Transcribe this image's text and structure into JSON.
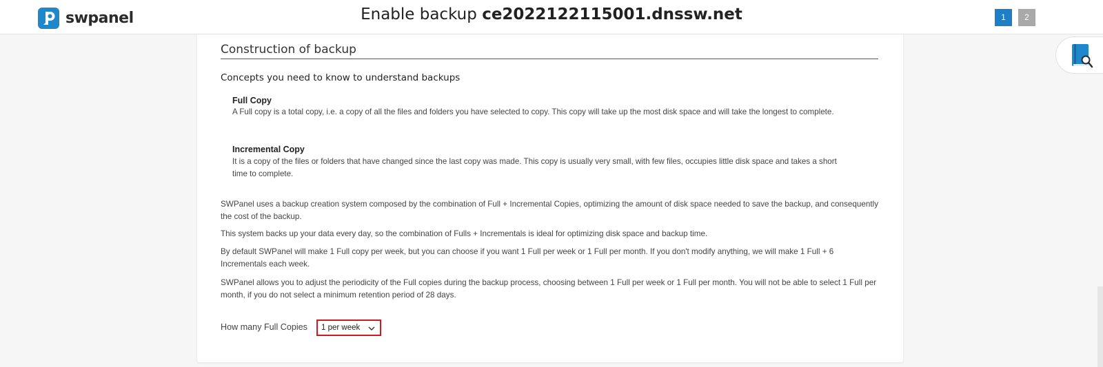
{
  "header": {
    "logo_text": "swpanel",
    "title_prefix": "Enable backup",
    "title_domain": "ce2022122115001.dnssw.net",
    "steps": [
      "1",
      "2"
    ]
  },
  "section": {
    "title": "Construction of backup",
    "concepts_heading": "Concepts you need to know to understand backups",
    "full_copy": {
      "term": "Full Copy",
      "desc": "A Full copy is a total copy, i.e. a copy of all the files and folders you have selected to copy. This copy will take up the most disk space and will take the longest to complete."
    },
    "incremental_copy": {
      "term": "Incremental Copy",
      "desc": "It is a copy of the files or folders that have changed since the last copy was made. This copy is usually very small, with few files, occupies little disk space and takes a short time to complete."
    },
    "paragraphs": [
      "SWPanel uses a backup creation system composed by the combination of Full + Incremental Copies, optimizing the amount of disk space needed to save the backup, and consequently the cost of the backup.",
      "This system backs up your data every day, so the combination of Fulls + Incrementals is ideal for optimizing disk space and backup time.",
      "By default SWPanel will make 1 Full copy per week, but you can choose if you want 1 Full per week or 1 Full per month. If you don't modify anything, we will make 1 Full + 6 Incrementals each week.",
      "SWPanel allows you to adjust the periodicity of the Full copies during the backup process, choosing between 1 Full per week or 1 Full per month. You will not be able to select 1 Full per month, if you do not select a minimum retention period of 28 days."
    ],
    "full_copies_field": {
      "label": "How many Full Copies",
      "selected": "1 per week"
    }
  },
  "colors": {
    "brand": "#1f87cc",
    "active_step": "#1f7fc6",
    "inactive_step": "#a9a9a9",
    "highlight": "#d0181e"
  },
  "icons": {
    "logo": "swpanel-logo-icon",
    "help": "help-book-search-icon",
    "select_caret": "chevron-down-icon"
  }
}
